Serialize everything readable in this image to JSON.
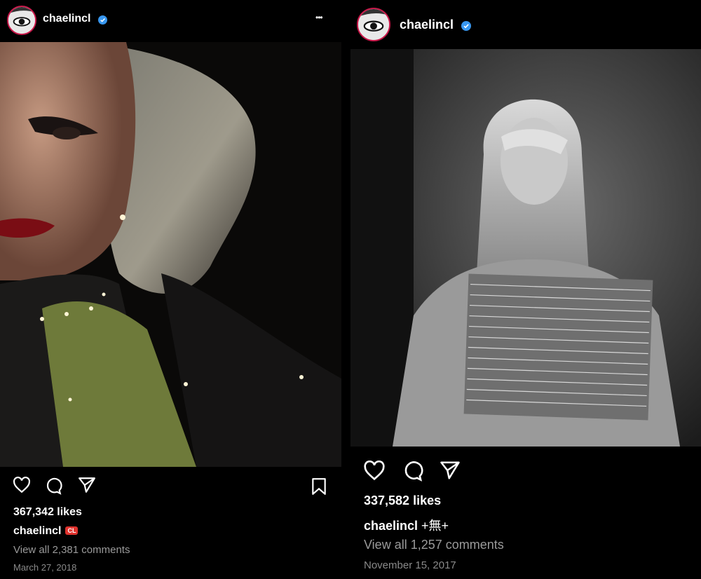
{
  "posts": [
    {
      "username": "chaelincl",
      "likes": "367,342 likes",
      "caption_user": "chaelincl",
      "caption_badge": "CL",
      "comments": "View all 2,381 comments",
      "date": "March 27, 2018",
      "more_label": "•••"
    },
    {
      "username": "chaelincl",
      "likes": "337,582 likes",
      "caption_user": "chaelincl",
      "caption_suffix": "+無+",
      "comments": "View all 1,257 comments",
      "date": "November 15, 2017"
    }
  ],
  "icons": [
    "heart-icon",
    "comment-icon",
    "share-icon",
    "bookmark-icon",
    "more-icon",
    "verified-badge-icon"
  ],
  "colors": {
    "background": "#000000",
    "text": "#ffffff",
    "muted": "#9a9a9a",
    "verified": "#3897f0",
    "badge": "#e0322d"
  }
}
